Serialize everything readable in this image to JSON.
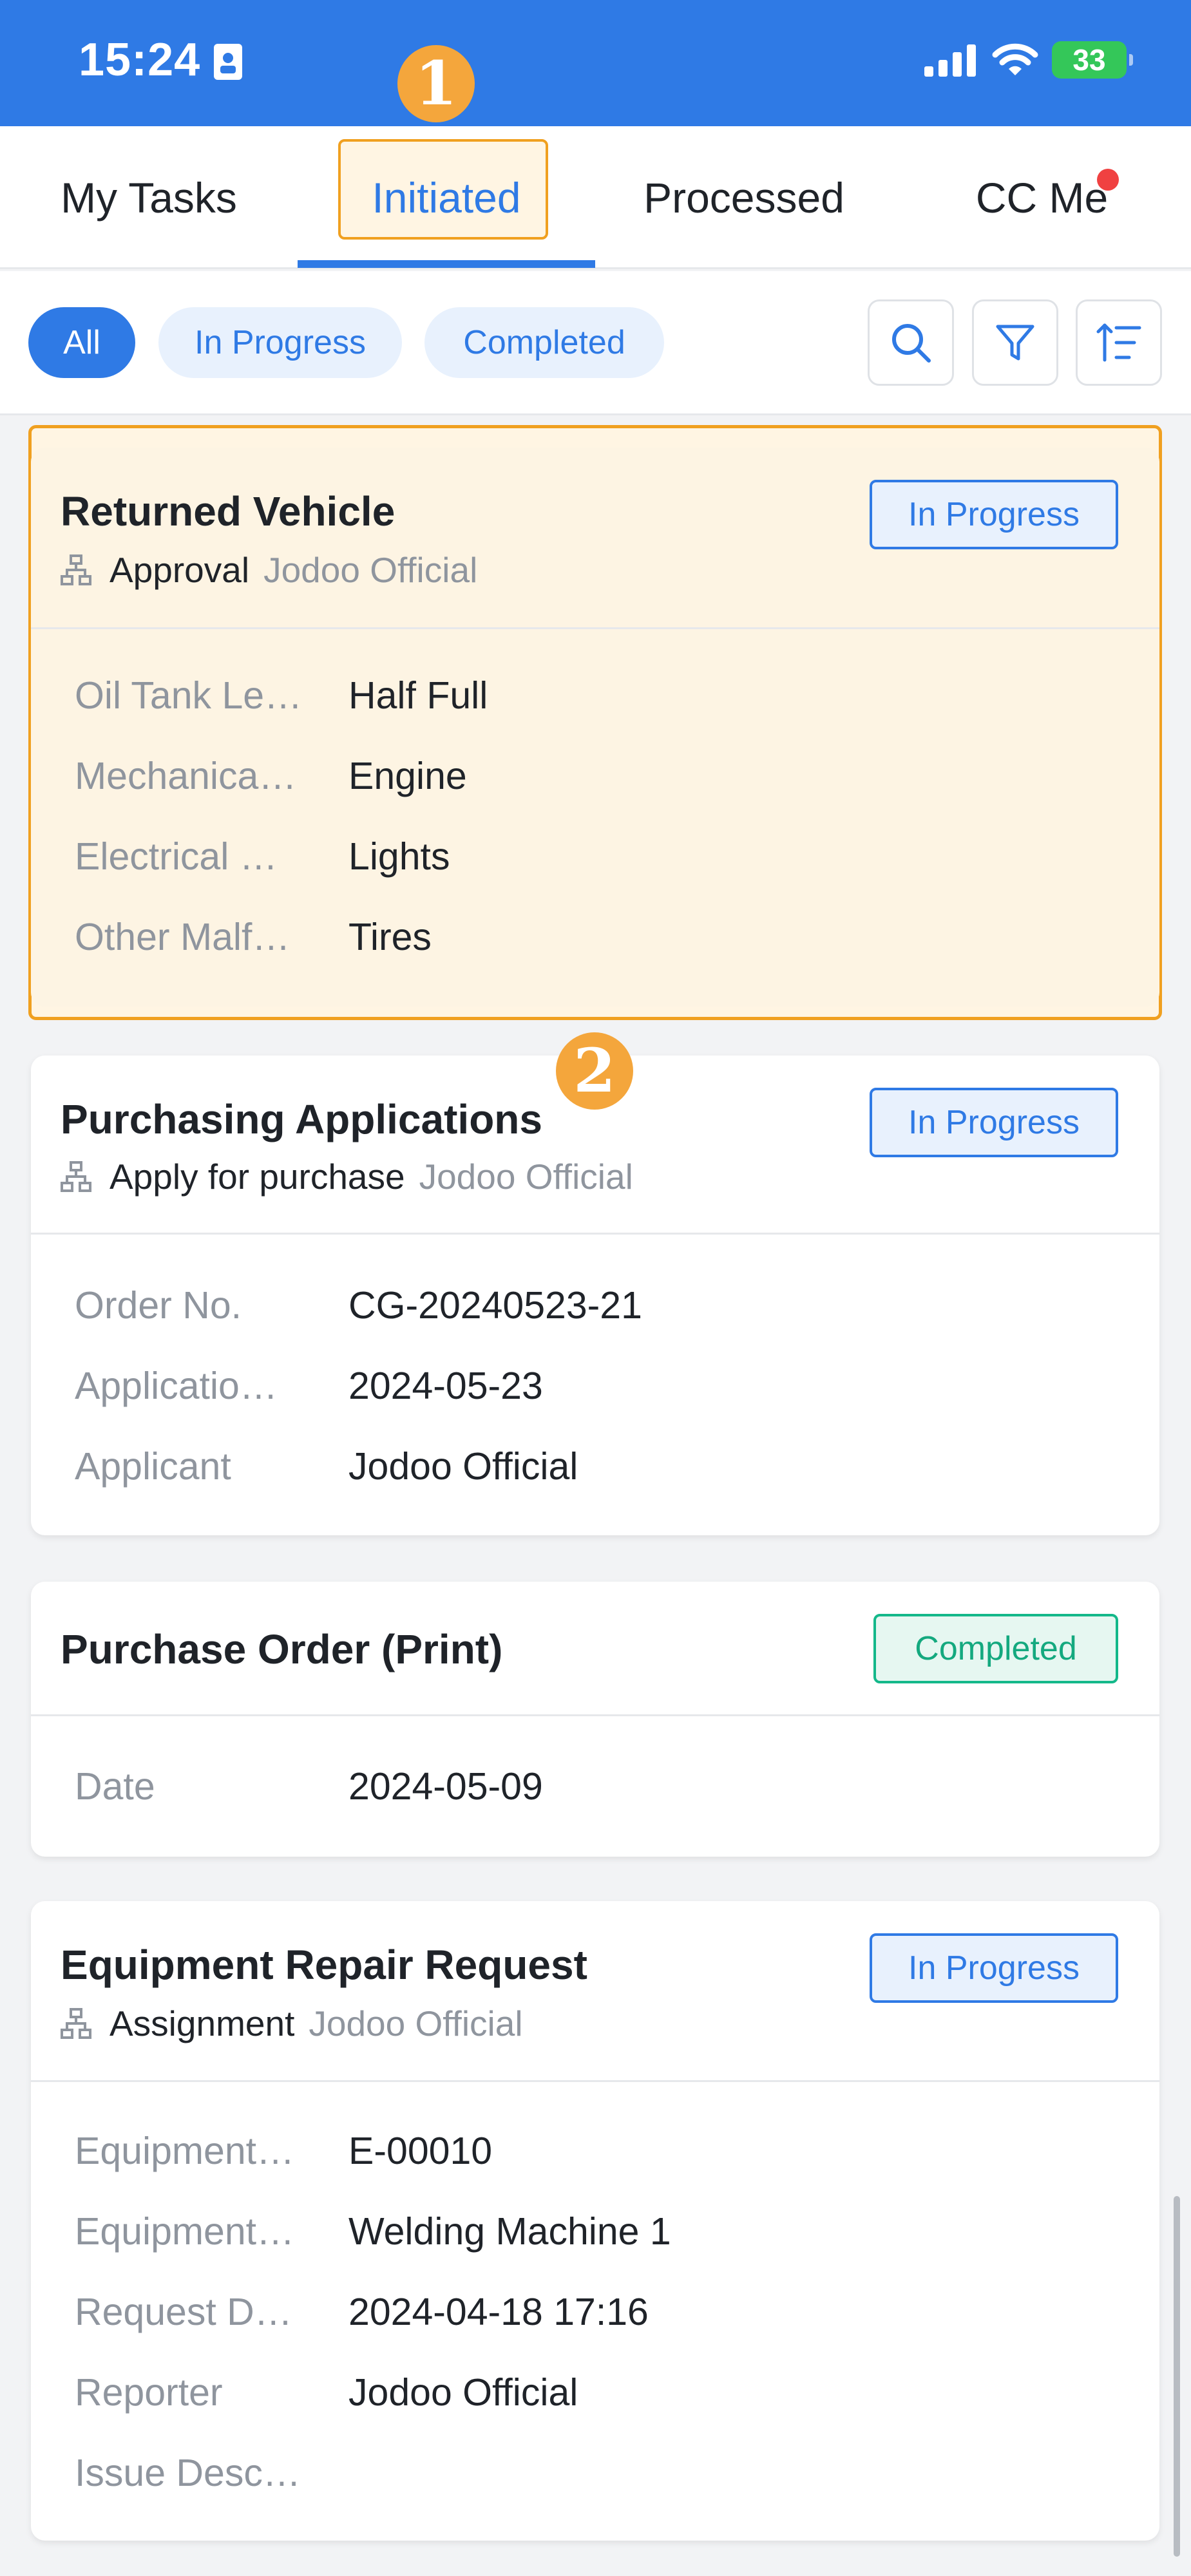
{
  "status_bar": {
    "time": "15:24",
    "battery": "33"
  },
  "tabs": [
    {
      "label": "My Tasks"
    },
    {
      "label": "Initiated"
    },
    {
      "label": "Processed"
    },
    {
      "label": "CC Me"
    }
  ],
  "markers": {
    "one": "1",
    "two": "2"
  },
  "filters": {
    "all": "All",
    "in_progress": "In Progress",
    "completed": "Completed"
  },
  "colors": {
    "accent": "#2f7ae5",
    "highlight": "#f0a020",
    "completed": "#14b88a",
    "notification_dot": "#f04141"
  },
  "cards": [
    {
      "title": "Returned Vehicle",
      "node": "Approval",
      "owner": "Jodoo Official",
      "status": "In Progress",
      "fields": [
        {
          "label": "Oil Tank Le…",
          "value": "Half Full"
        },
        {
          "label": "Mechanica…",
          "value": "Engine"
        },
        {
          "label": "Electrical …",
          "value": "Lights"
        },
        {
          "label": "Other Malf…",
          "value": "Tires"
        }
      ]
    },
    {
      "title": "Purchasing Applications",
      "node": "Apply for purchase",
      "owner": "Jodoo Official",
      "status": "In Progress",
      "fields": [
        {
          "label": "Order No.",
          "value": "CG-20240523-21"
        },
        {
          "label": "Applicatio…",
          "value": "2024-05-23"
        },
        {
          "label": "Applicant",
          "value": "Jodoo Official"
        }
      ]
    },
    {
      "title": "Purchase Order (Print)",
      "status": "Completed",
      "fields": [
        {
          "label": "Date",
          "value": "2024-05-09"
        }
      ]
    },
    {
      "title": "Equipment Repair Request",
      "node": "Assignment",
      "owner": "Jodoo Official",
      "status": "In Progress",
      "fields": [
        {
          "label": "Equipment…",
          "value": "E-00010"
        },
        {
          "label": "Equipment…",
          "value": "Welding Machine 1"
        },
        {
          "label": "Request D…",
          "value": "2024-04-18 17:16"
        },
        {
          "label": "Reporter",
          "value": "Jodoo Official"
        },
        {
          "label": "Issue Desc…",
          "value": ""
        }
      ]
    }
  ]
}
